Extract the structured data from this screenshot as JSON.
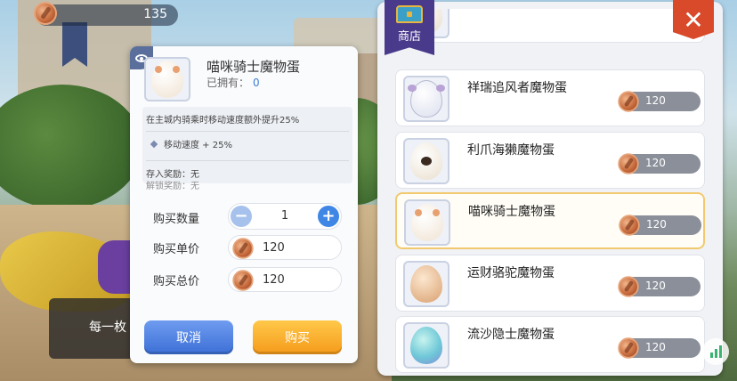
{
  "currency": {
    "amount": "135"
  },
  "background": {
    "banner_text": "每一枚"
  },
  "modal": {
    "item_name": "喵咪骑士魔物蛋",
    "owned_label": "已拥有：",
    "owned_count": "0",
    "description": "在主城内骑乘时移动速度额外提升25%",
    "stat": "移动速度 + 25%",
    "deposit_reward": "存入奖励：无",
    "unlock_reward": "解锁奖励：无",
    "qty_label": "购买数量",
    "quantity": "1",
    "unit_price_label": "购买单价",
    "unit_price": "120",
    "total_price_label": "购买总价",
    "total_price": "120",
    "cancel_label": "取消",
    "buy_label": "购买"
  },
  "shop": {
    "title": "商店",
    "close_label": "✕",
    "items": [
      {
        "name": "",
        "price": ""
      },
      {
        "name": "祥瑞追风者魔物蛋",
        "price": "120"
      },
      {
        "name": "利爪海獭魔物蛋",
        "price": "120"
      },
      {
        "name": "喵咪骑士魔物蛋",
        "price": "120",
        "selected": true
      },
      {
        "name": "运财骆驼魔物蛋",
        "price": "120"
      },
      {
        "name": "流沙隐士魔物蛋",
        "price": "120"
      }
    ]
  },
  "colors": {
    "cancel_button": "#3c6fd6",
    "buy_button": "#f59a1a",
    "shop_tab": "#4a3a8c",
    "close_button": "#d84a2a",
    "selected_border": "#f2c96e"
  }
}
